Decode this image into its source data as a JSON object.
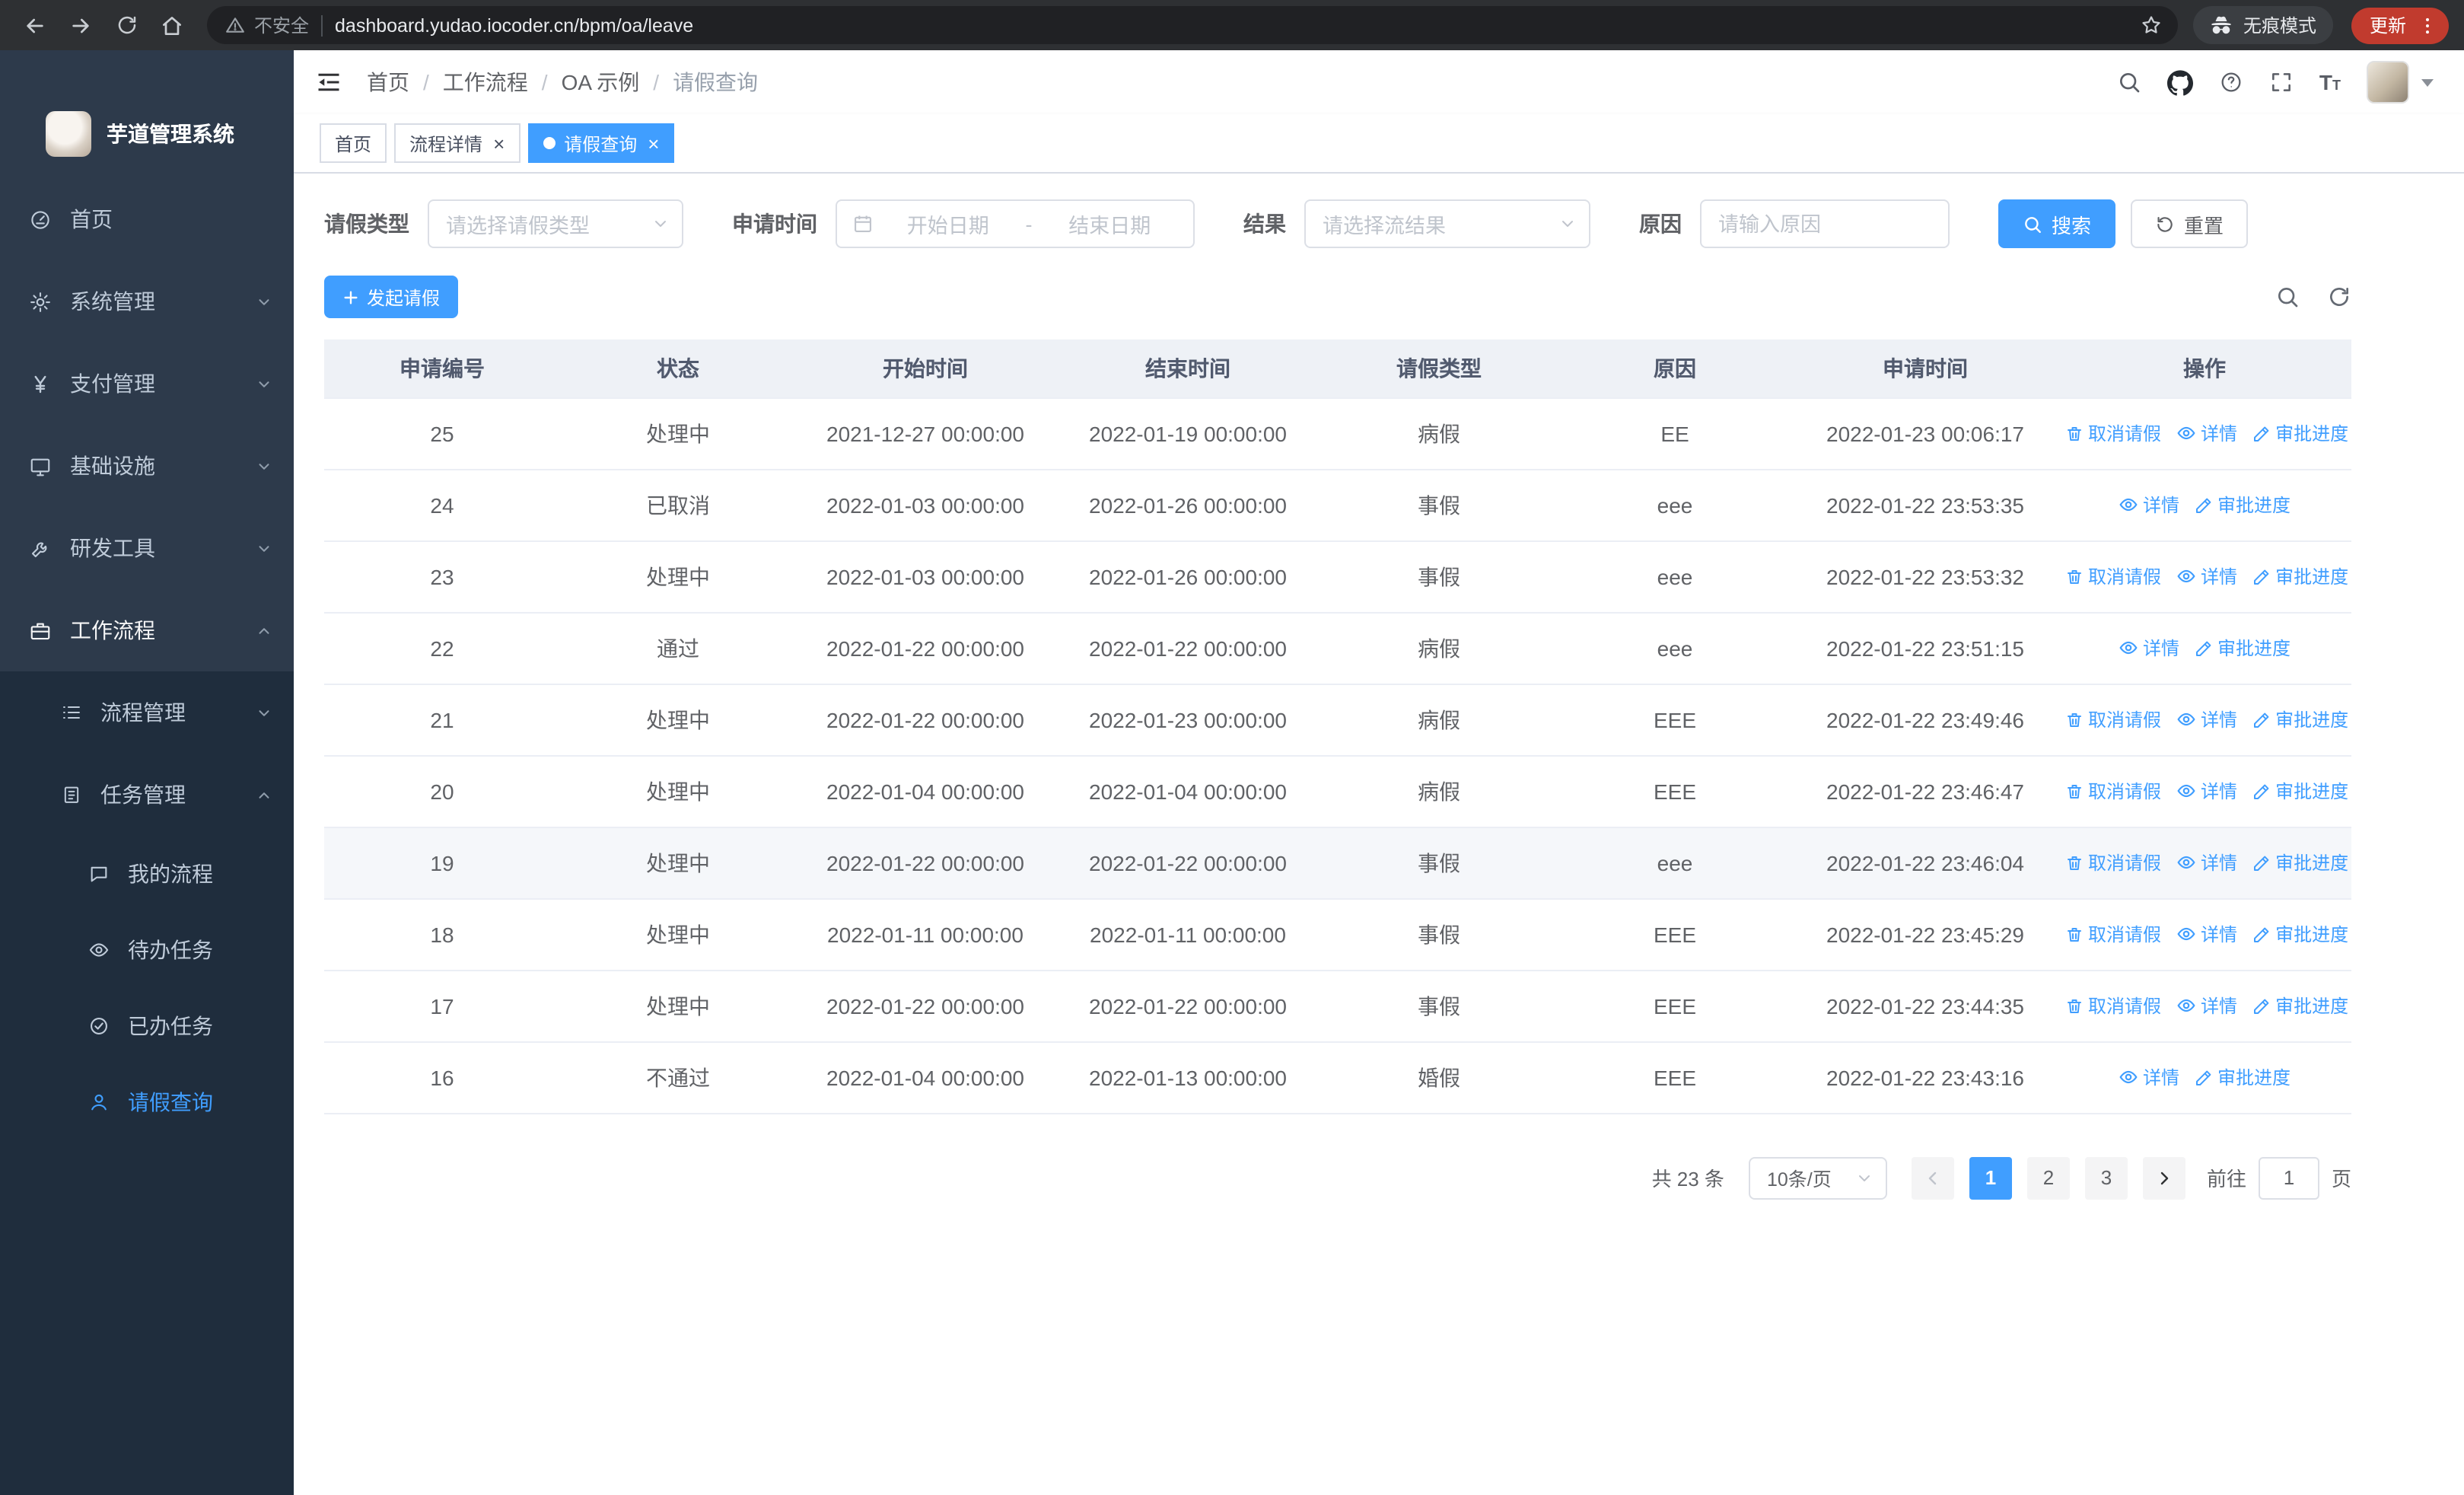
{
  "browser": {
    "security_warning": "不安全",
    "url": "dashboard.yudao.iocoder.cn/bpm/oa/leave",
    "incognito_label": "无痕模式",
    "update_label": "更新"
  },
  "sidebar": {
    "app_title": "芋道管理系统",
    "items": [
      {
        "label": "首页",
        "icon": "dashboard-icon",
        "arrow": "none"
      },
      {
        "label": "系统管理",
        "icon": "gear-icon",
        "arrow": "down"
      },
      {
        "label": "支付管理",
        "icon": "yen-icon",
        "arrow": "down"
      },
      {
        "label": "基础设施",
        "icon": "monitor-icon",
        "arrow": "down"
      },
      {
        "label": "研发工具",
        "icon": "wrench-icon",
        "arrow": "down"
      },
      {
        "label": "工作流程",
        "icon": "briefcase-icon",
        "arrow": "up",
        "expanded": true
      }
    ],
    "submenu": [
      {
        "label": "流程管理",
        "icon": "list-icon",
        "arrow": "down"
      },
      {
        "label": "任务管理",
        "icon": "clipboard-icon",
        "arrow": "up",
        "expanded": true
      }
    ],
    "task_items": [
      {
        "label": "我的流程",
        "icon": "chat-icon",
        "active": false
      },
      {
        "label": "待办任务",
        "icon": "eye-icon",
        "active": false
      },
      {
        "label": "已办任务",
        "icon": "check-circle-icon",
        "active": false
      },
      {
        "label": "请假查询",
        "icon": "user-icon",
        "active": true
      }
    ]
  },
  "header": {
    "breadcrumb": [
      "首页",
      "工作流程",
      "OA 示例",
      "请假查询"
    ]
  },
  "tabs": [
    {
      "label": "首页",
      "closable": false,
      "active": false
    },
    {
      "label": "流程详情",
      "closable": true,
      "active": false
    },
    {
      "label": "请假查询",
      "closable": true,
      "active": true
    }
  ],
  "filters": {
    "leave_type_label": "请假类型",
    "leave_type_placeholder": "请选择请假类型",
    "apply_time_label": "申请时间",
    "start_date_placeholder": "开始日期",
    "range_separator": "-",
    "end_date_placeholder": "结束日期",
    "result_label": "结果",
    "result_placeholder": "请选择流结果",
    "reason_label": "原因",
    "reason_placeholder": "请输入原因",
    "search_button": "搜索",
    "reset_button": "重置"
  },
  "toolbar": {
    "create_button": "发起请假"
  },
  "table": {
    "columns": [
      "申请编号",
      "状态",
      "开始时间",
      "结束时间",
      "请假类型",
      "原因",
      "申请时间",
      "操作"
    ],
    "actions_def": {
      "cancel": {
        "label": "取消请假",
        "icon": "trash-icon"
      },
      "detail": {
        "label": "详情",
        "icon": "eye-icon"
      },
      "progress": {
        "label": "审批进度",
        "icon": "edit-icon"
      }
    },
    "rows": [
      {
        "id": "25",
        "status": "处理中",
        "start": "2021-12-27 00:00:00",
        "end": "2022-01-19 00:00:00",
        "type": "病假",
        "reason": "EE",
        "apply_time": "2022-01-23 00:06:17",
        "actions": [
          "cancel",
          "detail",
          "progress"
        ],
        "highlighted": false
      },
      {
        "id": "24",
        "status": "已取消",
        "start": "2022-01-03 00:00:00",
        "end": "2022-01-26 00:00:00",
        "type": "事假",
        "reason": "eee",
        "apply_time": "2022-01-22 23:53:35",
        "actions": [
          "detail",
          "progress"
        ],
        "highlighted": false
      },
      {
        "id": "23",
        "status": "处理中",
        "start": "2022-01-03 00:00:00",
        "end": "2022-01-26 00:00:00",
        "type": "事假",
        "reason": "eee",
        "apply_time": "2022-01-22 23:53:32",
        "actions": [
          "cancel",
          "detail",
          "progress"
        ],
        "highlighted": false
      },
      {
        "id": "22",
        "status": "通过",
        "start": "2022-01-22 00:00:00",
        "end": "2022-01-22 00:00:00",
        "type": "病假",
        "reason": "eee",
        "apply_time": "2022-01-22 23:51:15",
        "actions": [
          "detail",
          "progress"
        ],
        "highlighted": false
      },
      {
        "id": "21",
        "status": "处理中",
        "start": "2022-01-22 00:00:00",
        "end": "2022-01-23 00:00:00",
        "type": "病假",
        "reason": "EEE",
        "apply_time": "2022-01-22 23:49:46",
        "actions": [
          "cancel",
          "detail",
          "progress"
        ],
        "highlighted": false
      },
      {
        "id": "20",
        "status": "处理中",
        "start": "2022-01-04 00:00:00",
        "end": "2022-01-04 00:00:00",
        "type": "病假",
        "reason": "EEE",
        "apply_time": "2022-01-22 23:46:47",
        "actions": [
          "cancel",
          "detail",
          "progress"
        ],
        "highlighted": false
      },
      {
        "id": "19",
        "status": "处理中",
        "start": "2022-01-22 00:00:00",
        "end": "2022-01-22 00:00:00",
        "type": "事假",
        "reason": "eee",
        "apply_time": "2022-01-22 23:46:04",
        "actions": [
          "cancel",
          "detail",
          "progress"
        ],
        "highlighted": true
      },
      {
        "id": "18",
        "status": "处理中",
        "start": "2022-01-11 00:00:00",
        "end": "2022-01-11 00:00:00",
        "type": "事假",
        "reason": "EEE",
        "apply_time": "2022-01-22 23:45:29",
        "actions": [
          "cancel",
          "detail",
          "progress"
        ],
        "highlighted": false
      },
      {
        "id": "17",
        "status": "处理中",
        "start": "2022-01-22 00:00:00",
        "end": "2022-01-22 00:00:00",
        "type": "事假",
        "reason": "EEE",
        "apply_time": "2022-01-22 23:44:35",
        "actions": [
          "cancel",
          "detail",
          "progress"
        ],
        "highlighted": false
      },
      {
        "id": "16",
        "status": "不通过",
        "start": "2022-01-04 00:00:00",
        "end": "2022-01-13 00:00:00",
        "type": "婚假",
        "reason": "EEE",
        "apply_time": "2022-01-22 23:43:16",
        "actions": [
          "detail",
          "progress"
        ],
        "highlighted": false
      }
    ]
  },
  "pagination": {
    "total_text": "共 23 条",
    "page_size": "10条/页",
    "pages": [
      "1",
      "2",
      "3"
    ],
    "active_page": "1",
    "goto_label": "前往",
    "goto_value": "1",
    "goto_suffix": "页"
  },
  "colors": {
    "primary": "#409eff",
    "sidebar_bg": "#2d3a4b",
    "sidebar_sub_bg": "#1f2d3d",
    "active_tab_bg": "#409eff"
  }
}
